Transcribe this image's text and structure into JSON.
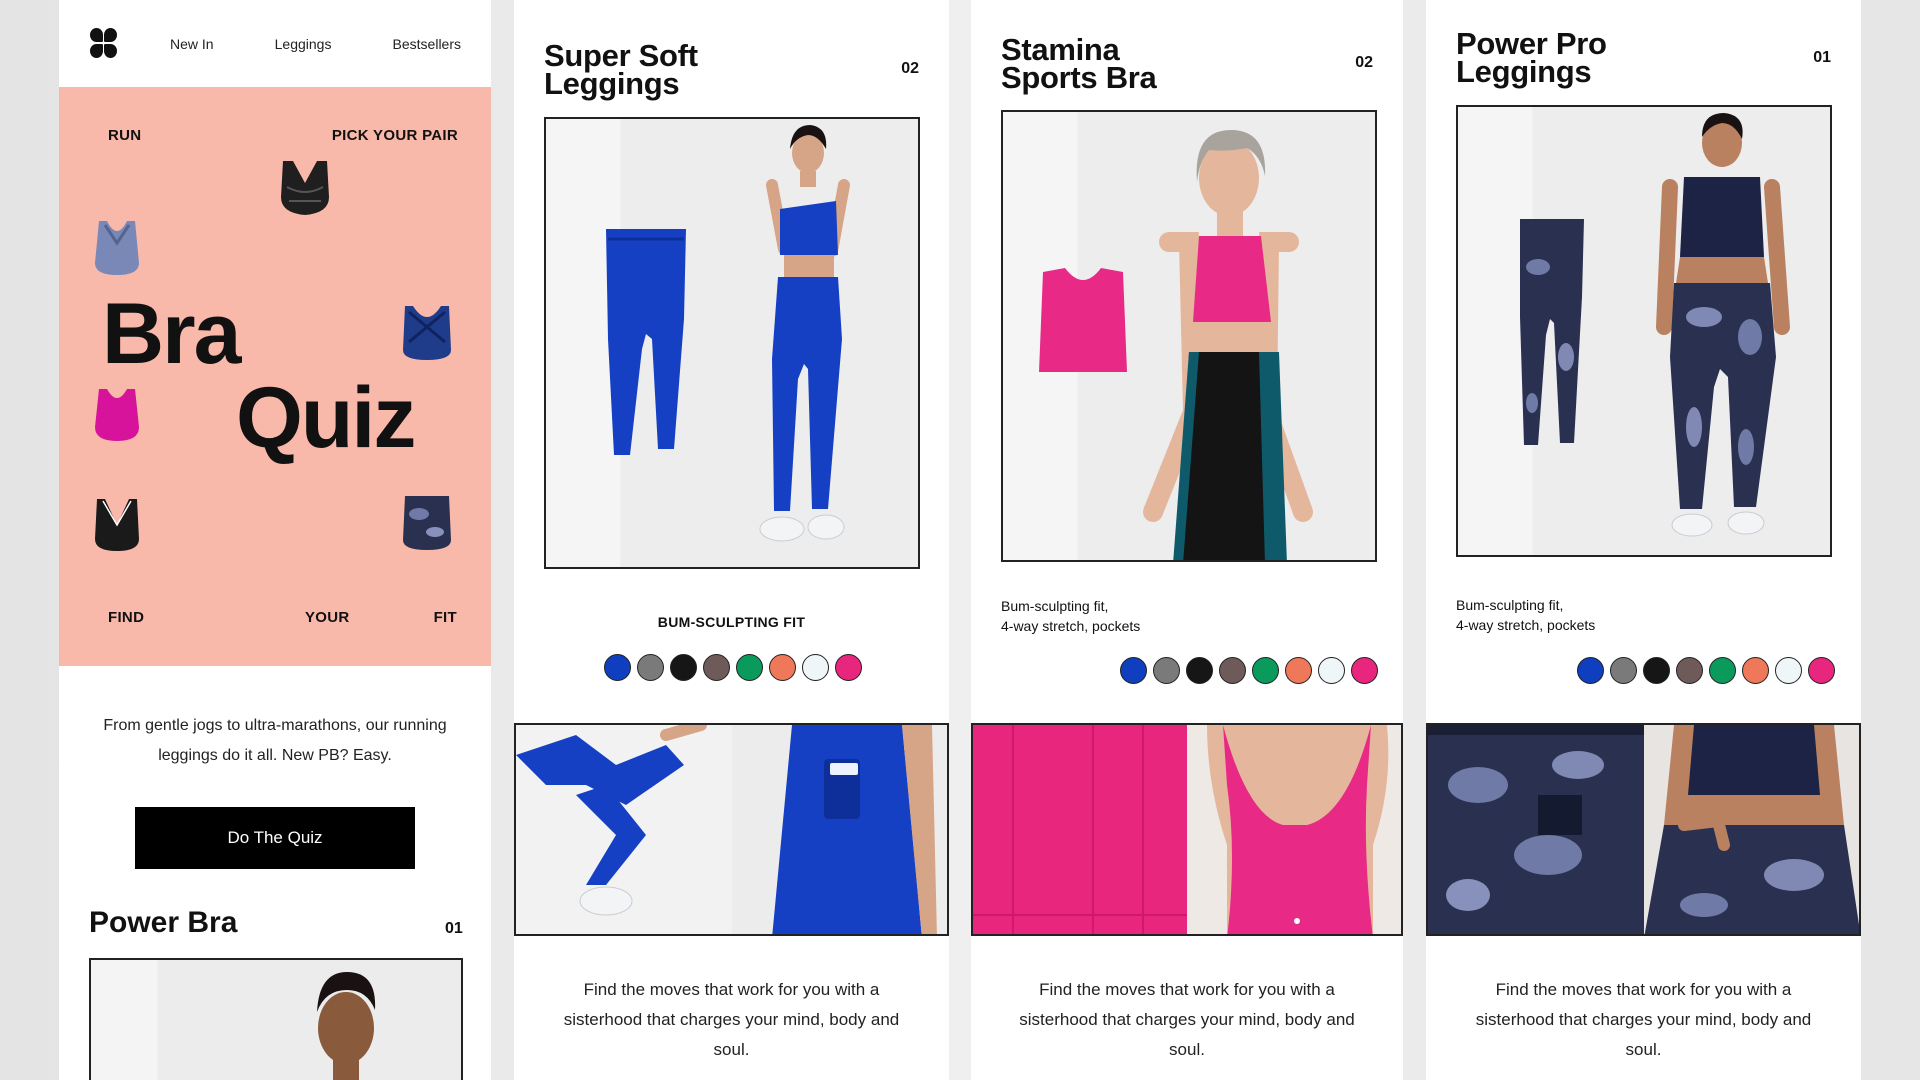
{
  "panel1": {
    "nav": [
      "New In",
      "Leggings",
      "Bestsellers"
    ],
    "hero": {
      "label_tl": "RUN",
      "label_tr": "PICK YOUR PAIR",
      "title_1": "Bra",
      "title_2": "Quiz",
      "label_find": "FIND",
      "label_your": "YOUR",
      "label_fit": "FIT"
    },
    "copy": "From gentle jogs to ultra-marathons, our running leggings do it all. New PB? Easy.",
    "button": "Do The Quiz",
    "product_title": "Power Bra",
    "product_number": "01"
  },
  "panel2": {
    "title_line1": "Super Soft",
    "title_line2": "Leggings",
    "number": "02",
    "feature": "BUM-SCULPTING FIT",
    "copy": "Find the moves that work for you with a sisterhood that charges your mind, body and soul."
  },
  "panel3": {
    "title_line1": "Stamina",
    "title_line2": "Sports Bra",
    "number": "02",
    "feature_line1": "Bum-sculpting fit,",
    "feature_line2": "4-way stretch, pockets",
    "copy": "Find the moves that work for you with a sisterhood that charges your mind, body and soul."
  },
  "panel4": {
    "title_line1": "Power Pro",
    "title_line2": "Leggings",
    "number": "01",
    "feature_line1": "Bum-sculpting fit,",
    "feature_line2": "4-way stretch, pockets",
    "copy": "Find the moves that work for you with a sisterhood that charges your mind, body and soul."
  },
  "swatch_colors": [
    "#0f3fbf",
    "#7a7a7a",
    "#161616",
    "#6f5a5a",
    "#0a9a5c",
    "#f0785a",
    "#eef6f8",
    "#e8267e"
  ],
  "colors": {
    "hero_background": "#f9b9aa",
    "royal_blue": "#1540c4",
    "hot_pink": "#e82a86",
    "navy_camo": "#2a3050"
  }
}
